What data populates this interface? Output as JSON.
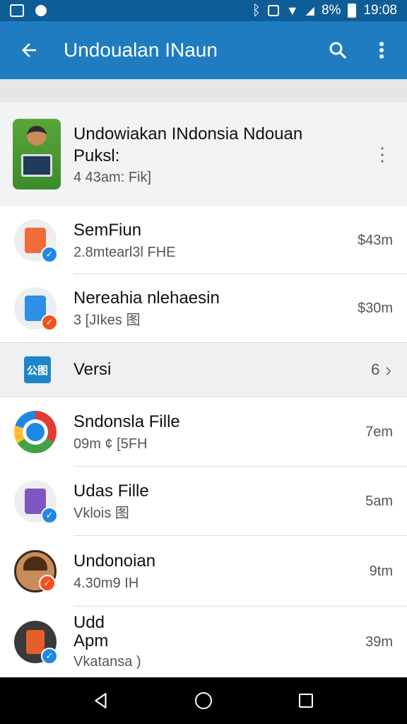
{
  "status_bar": {
    "battery": "8%",
    "time": "19:08"
  },
  "app_bar": {
    "title": "Undoualan INaun",
    "back_icon": "arrow-back-icon",
    "search_icon": "search-icon",
    "more_icon": "more-vert-icon"
  },
  "header": {
    "title": "Undowiakan INdonsia Ndouan Puksl:",
    "subtitle": "4 43am: Fik]"
  },
  "items": [
    {
      "title": "SemFiun",
      "subtitle": "2.8mtearl3l FHE",
      "size": "$43m",
      "icon_color": "#ef6c3a",
      "badge_color": "#1e88e5",
      "badge": "✓"
    },
    {
      "title": "Nereahia nlehaesin",
      "subtitle": "3 [JIkes 图",
      "size": "$30m",
      "icon_color": "#2f8ee5",
      "badge_color": "#f4511e",
      "badge": "✓"
    }
  ],
  "version": {
    "label": "Versi",
    "count": "6",
    "icon_text": "公图"
  },
  "files": [
    {
      "title": "Sndonsla Fille",
      "subtitle": "09m ¢ [5FH",
      "size": "7em"
    },
    {
      "title": "Udas Fille",
      "subtitle": "Vklois 图",
      "size": "5am"
    },
    {
      "title": "Undonoian",
      "subtitle": "4.30m9 IH",
      "size": "9tm"
    },
    {
      "title": "Udd Apm",
      "subtitle": "Vkatansa )",
      "size": "39m"
    }
  ],
  "colors": {
    "status_bar": "#0f5d96",
    "app_bar": "#1f7cc0",
    "accent_blue": "#1e88e5",
    "accent_orange": "#f4511e"
  }
}
